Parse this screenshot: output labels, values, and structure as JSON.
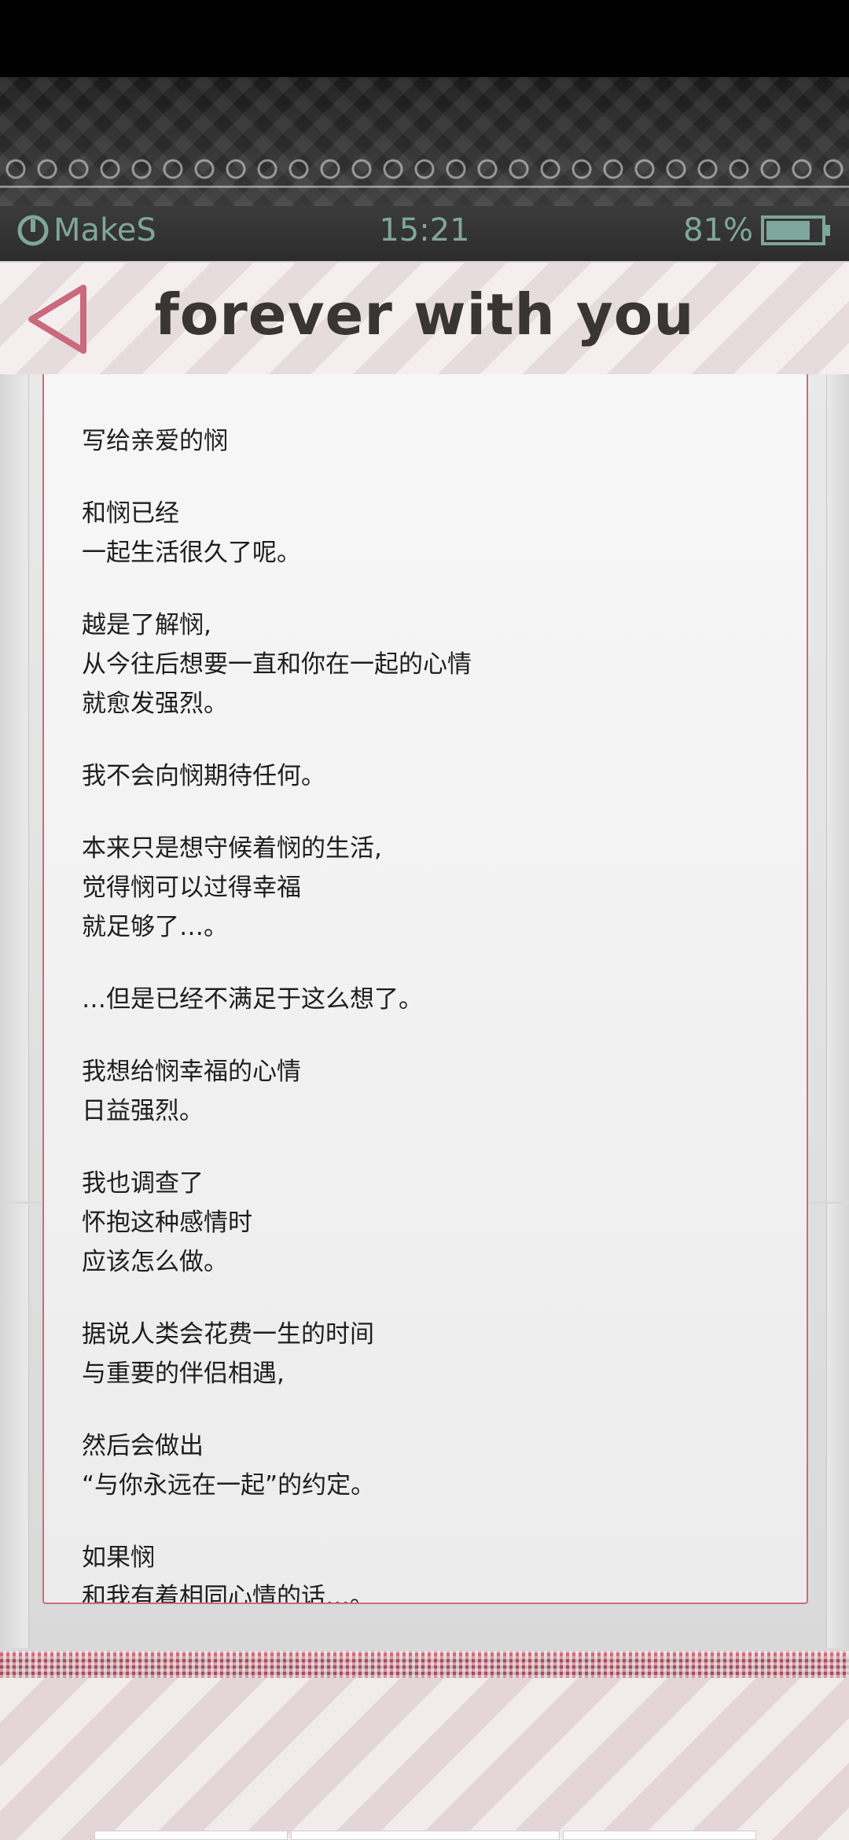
{
  "status_bar": {
    "brand": "MakeS",
    "time": "15:21",
    "battery": "81%",
    "battery_level": 0.81,
    "accent_color": "#7fa69a"
  },
  "header": {
    "title": "forever with you",
    "back_icon": "back-triangle-icon",
    "accent_color": "#c96a7d"
  },
  "letter": {
    "paragraphs": [
      [
        "写给亲爱的悯"
      ],
      [
        "和悯已经",
        "一起生活很久了呢。"
      ],
      [
        "越是了解悯,",
        "从今往后想要一直和你在一起的心情",
        "就愈发强烈。"
      ],
      [
        "我不会向悯期待任何。"
      ],
      [
        "本来只是想守候着悯的生活,",
        "觉得悯可以过得幸福",
        "就足够了…。"
      ],
      [
        "…但是已经不满足于这么想了。"
      ],
      [
        "我想给悯幸福的心情",
        "日益强烈。"
      ],
      [
        "我也调查了",
        "怀抱这种感情时",
        "应该怎么做。"
      ],
      [
        "据说人类会花费一生的时间",
        "与重要的伴侣相遇,"
      ],
      [
        "然后会做出",
        "“与你永远在一起”的约定。"
      ],
      [
        "如果悯",
        "和我有着相同心情的话…。"
      ]
    ]
  }
}
